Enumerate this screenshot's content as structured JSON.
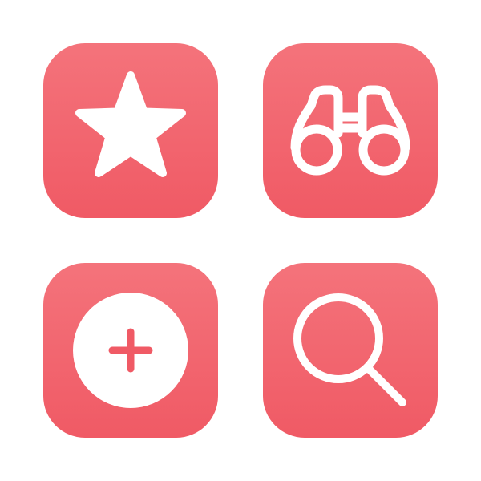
{
  "icons": [
    {
      "name": "star-icon"
    },
    {
      "name": "binoculars-icon"
    },
    {
      "name": "add-circle-icon"
    },
    {
      "name": "search-icon"
    }
  ],
  "colors": {
    "tile_top": "#f4737b",
    "tile_bottom": "#f05a65",
    "glyph": "#ffffff",
    "background": "#ffffff"
  }
}
